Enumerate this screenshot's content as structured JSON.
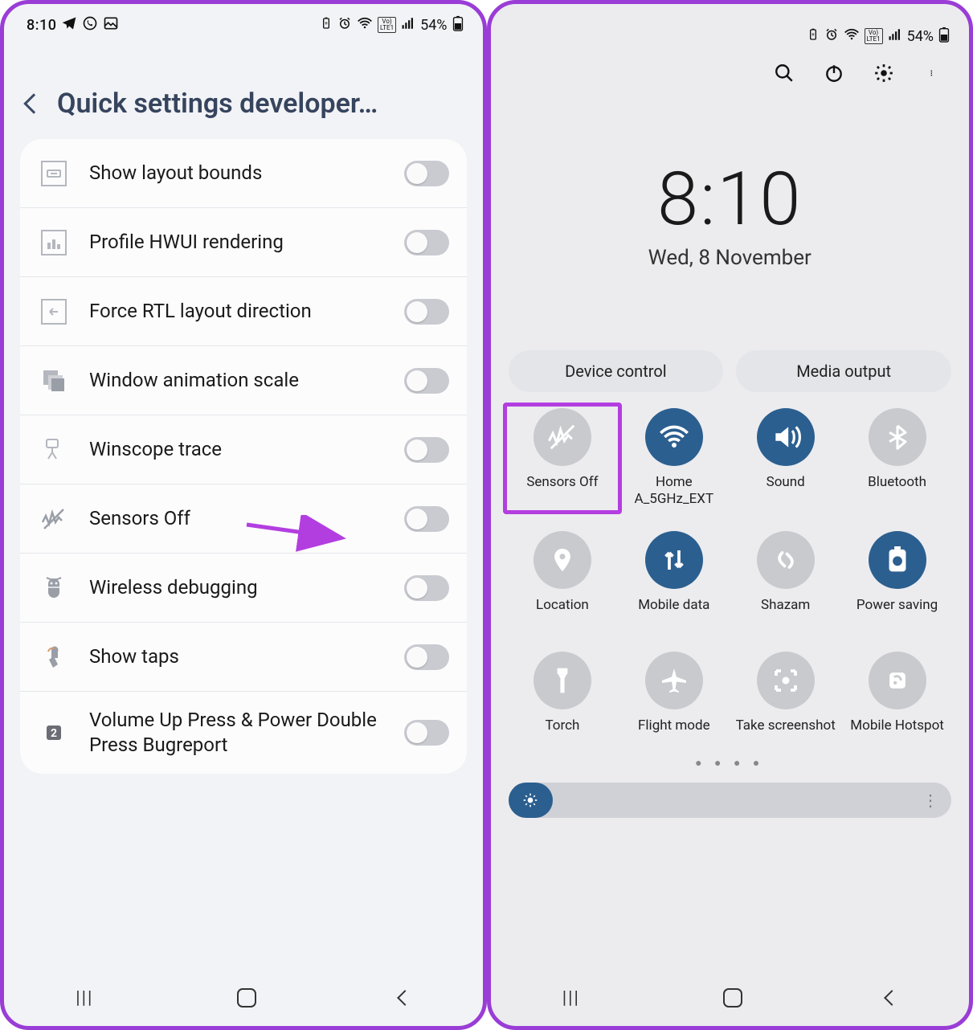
{
  "status": {
    "time": "8:10",
    "battery": "54%"
  },
  "left": {
    "title": "Quick settings developer…",
    "rows": [
      {
        "label": "Show layout bounds"
      },
      {
        "label": "Profile HWUI rendering"
      },
      {
        "label": "Force RTL layout direction"
      },
      {
        "label": "Window animation scale"
      },
      {
        "label": "Winscope trace"
      },
      {
        "label": "Sensors Off"
      },
      {
        "label": "Wireless debugging"
      },
      {
        "label": "Show taps"
      },
      {
        "label": "Volume Up Press & Power Double Press Bugreport"
      }
    ]
  },
  "right": {
    "time": "8:10",
    "date": "Wed, 8 November",
    "pills": {
      "device": "Device control",
      "media": "Media output"
    },
    "tiles": [
      {
        "label": "Sensors Off",
        "on": false,
        "highlight": true
      },
      {
        "label": "Home A_5GHz_EXT",
        "on": true
      },
      {
        "label": "Sound",
        "on": true
      },
      {
        "label": "Bluetooth",
        "on": false
      },
      {
        "label": "Location",
        "on": false
      },
      {
        "label": "Mobile data",
        "on": true
      },
      {
        "label": "Shazam",
        "on": false
      },
      {
        "label": "Power saving",
        "on": true
      },
      {
        "label": "Torch",
        "on": false
      },
      {
        "label": "Flight mode",
        "on": false
      },
      {
        "label": "Take screenshot",
        "on": false
      },
      {
        "label": "Mobile Hotspot",
        "on": false
      }
    ]
  }
}
